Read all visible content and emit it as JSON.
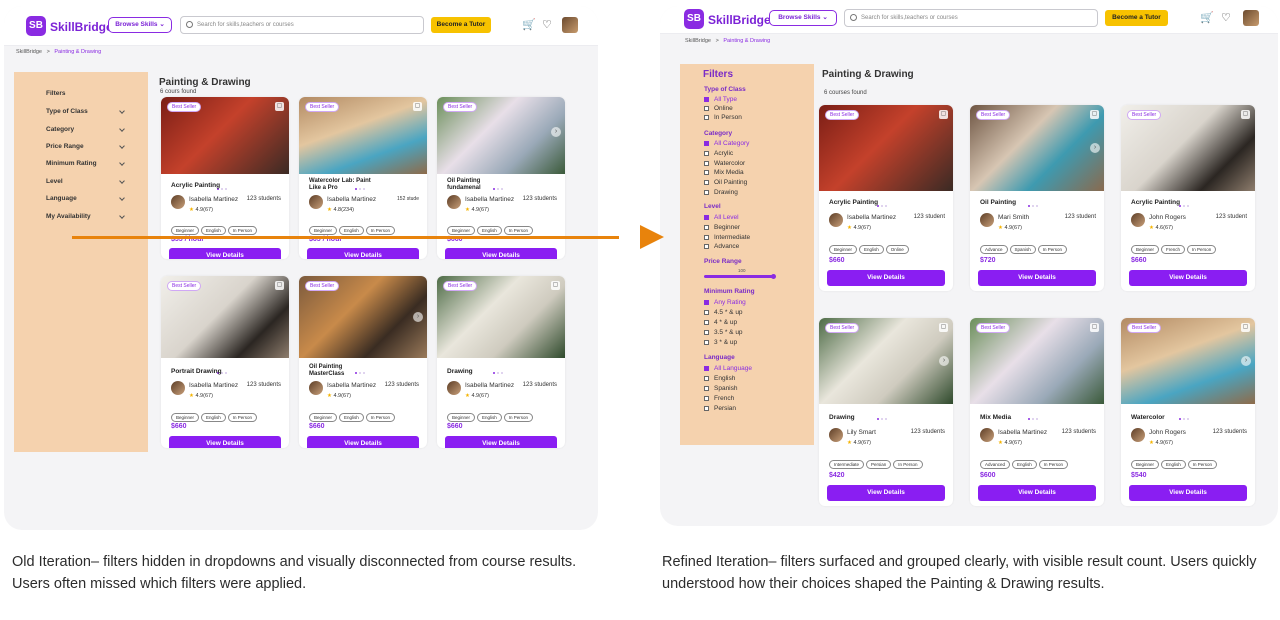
{
  "old": {
    "logo_badge": "SB",
    "logo_text": "SkillBridge",
    "browse": "Browse Skills",
    "search_placeholder": "Search for skills,teachers or courses",
    "become_tutor": "Become a Tutor",
    "crumb_home": "SkillBridge",
    "crumb_sep": ">",
    "crumb_current": "Painting & Drawing",
    "filters_title": "Filters",
    "filter_rows": [
      "Type of Class",
      "Category",
      "Price Range",
      "Minimum Rating",
      "Level",
      "Language",
      "My Availability"
    ],
    "page_title": "Painting & Drawing",
    "count": "6 cours found",
    "cards": [
      {
        "badge": "Best Seller",
        "title": "Acrylic Painting",
        "instructor": "Isabella Martinez",
        "students": "123 students",
        "rating": "4.9(67)",
        "tags": [
          "Beginner",
          "English",
          "In Person"
        ],
        "price": "$55 / hour",
        "button": "View Details"
      },
      {
        "badge": "Best Seller",
        "title": "Watercolor Lab: Paint Like a Pro",
        "instructor": "Isabella Martinez",
        "students": "152 stude",
        "rating": "4.8(234)",
        "tags": [
          "Beginner",
          "English",
          "In Person"
        ],
        "price": "$65 / hour",
        "button": "View Details"
      },
      {
        "badge": "Best Seller",
        "title": "Oil Painting fundamenal",
        "instructor": "Isabella Martinez",
        "students": "123 students",
        "rating": "4.9(67)",
        "tags": [
          "Beginner",
          "English",
          "In Person"
        ],
        "price": "$660",
        "button": "View Details"
      },
      {
        "badge": "Best Seller",
        "title": "Portrait Drawing",
        "instructor": "Isabella Martinez",
        "students": "123 students",
        "rating": "4.9(67)",
        "tags": [
          "Beginner",
          "English",
          "In Person"
        ],
        "price": "$660",
        "button": "View Details"
      },
      {
        "badge": "Best Seller",
        "title": "Oil Painting MasterClass",
        "instructor": "Isabella Martinez",
        "students": "123 students",
        "rating": "4.9(67)",
        "tags": [
          "Beginner",
          "English",
          "In Person"
        ],
        "price": "$660",
        "button": "View Details"
      },
      {
        "badge": "Best Seller",
        "title": "Drawing",
        "instructor": "Isabella Martinez",
        "students": "123 students",
        "rating": "4.9(67)",
        "tags": [
          "Beginner",
          "English",
          "In Person"
        ],
        "price": "$660",
        "button": "View Details"
      }
    ]
  },
  "new": {
    "logo_badge": "SB",
    "logo_text": "SkillBridge",
    "browse": "Browse Skills",
    "search_placeholder": "Search for skills,teachers or courses",
    "become_tutor": "Become a Tutor",
    "crumb_home": "SkillBridge",
    "crumb_sep": ">",
    "crumb_current": "Painting & Drawing",
    "filters_title": "Filters",
    "groups": {
      "type": {
        "title": "Type of Class",
        "options": [
          "All Type",
          "Online",
          "In Person"
        ]
      },
      "category": {
        "title": "Category",
        "options": [
          "All Category",
          "Acrylic",
          "Watercolor",
          "Mix Media",
          "Oil Painting",
          "Drawing"
        ]
      },
      "level": {
        "title": "Level",
        "options": [
          "All Level",
          "Beginner",
          "Intermediate",
          "Advance"
        ]
      },
      "price": {
        "title": "Price Range",
        "value": "100",
        "fill": 1.0
      },
      "rating": {
        "title": "Minimum Rating",
        "options": [
          "Any Rating",
          "4.5 * & up",
          "4 * & up",
          "3.5 * & up",
          "3 * & up"
        ]
      },
      "language": {
        "title": "Language",
        "options": [
          "All Language",
          "English",
          "Spanish",
          "French",
          "Persian"
        ]
      }
    },
    "page_title": "Painting & Drawing",
    "count": "6 courses found",
    "cards": [
      {
        "badge": "Best Seller",
        "title": "Acrylic Painting",
        "instructor": "Isabella Martinez",
        "students": "123 student",
        "rating": "4.9(67)",
        "tags": [
          "Beginner",
          "English",
          "Online"
        ],
        "price": "$660",
        "button": "View Details"
      },
      {
        "badge": "Best Seller",
        "title": "Oil Painting",
        "instructor": "Mari Smith",
        "students": "123 student",
        "rating": "4.9(67)",
        "tags": [
          "Advance",
          "Spanish",
          "In Person"
        ],
        "price": "$720",
        "button": "View Details"
      },
      {
        "badge": "Best Seller",
        "title": "Acrylic Painting",
        "instructor": "John Rogers",
        "students": "123 student",
        "rating": "4.6(67)",
        "tags": [
          "Beginner",
          "French",
          "In Person"
        ],
        "price": "$660",
        "button": "View Details"
      },
      {
        "badge": "Best Seller",
        "title": "Drawing",
        "instructor": "Lily Smart",
        "students": "123 students",
        "rating": "4.9(67)",
        "tags": [
          "Intermediate",
          "Persian",
          "In Person"
        ],
        "price": "$420",
        "button": "View Details"
      },
      {
        "badge": "Best Seller",
        "title": "Mix Media",
        "instructor": "Isabella Martinez",
        "students": "123 students",
        "rating": "4.9(67)",
        "tags": [
          "Advanced",
          "English",
          "In Person"
        ],
        "price": "$600",
        "button": "View Details"
      },
      {
        "badge": "Best Seller",
        "title": "Watercolor",
        "instructor": "John Rogers",
        "students": "123 students",
        "rating": "4.9(67)",
        "tags": [
          "Beginner",
          "English",
          "In Person"
        ],
        "price": "$540",
        "button": "View Details"
      }
    ]
  },
  "captions": {
    "old": "Old Iteration– filters hidden in dropdowns and visually disconnected from course results. Users often missed which filters were applied.",
    "new": "Refined Iteration– filters surfaced and grouped clearly, with visible result count. Users quickly understood how their choices shaped the Painting & Drawing results."
  },
  "colors": {
    "accent": "#8a2be2",
    "button": "#8a1ef2",
    "tutor": "#f7c200",
    "sidebar": "#f5d2ae",
    "arrow": "#e8830c"
  },
  "icons": [
    "search-icon",
    "cart-icon",
    "heart-icon",
    "chevron-down-icon",
    "arrow-right-icon",
    "star-icon"
  ]
}
